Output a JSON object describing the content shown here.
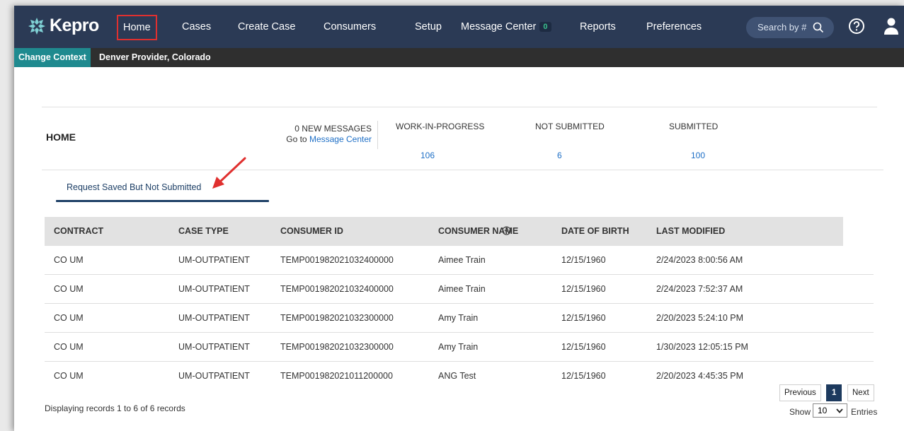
{
  "navbar": {
    "brand": "Kepro",
    "items": [
      {
        "label": "Home"
      },
      {
        "label": "Cases"
      },
      {
        "label": "Create Case"
      },
      {
        "label": "Consumers"
      },
      {
        "label": "Setup"
      },
      {
        "label": "Message Center",
        "badge": "0"
      },
      {
        "label": "Reports"
      },
      {
        "label": "Preferences"
      }
    ],
    "search_placeholder": "Search by #",
    "icons": [
      "search-icon",
      "help-icon",
      "user-icon"
    ],
    "active_highlight_color": "#e0302f",
    "background_color": "#2b3a55"
  },
  "context": {
    "button_label": "Change Context",
    "provider": "Denver Provider, Colorado"
  },
  "home": {
    "title": "HOME",
    "messages_count_text": "0 NEW MESSAGES",
    "goto_prefix": "Go to",
    "goto_link": "Message Center",
    "stats": [
      {
        "label": "WORK-IN-PROGRESS",
        "value": "106"
      },
      {
        "label": "NOT SUBMITTED",
        "value": "6"
      },
      {
        "label": "SUBMITTED",
        "value": "100"
      }
    ]
  },
  "tab": {
    "label": "Request Saved But Not Submitted"
  },
  "table": {
    "columns": [
      "CONTRACT",
      "CASE TYPE",
      "CONSUMER ID",
      "CONSUMER NAME",
      "DATE OF BIRTH",
      "LAST MODIFIED"
    ],
    "rows": [
      [
        "CO UM",
        "UM-OUTPATIENT",
        "TEMP001982021032400000",
        "Aimee Train",
        "12/15/1960",
        "2/24/2023 8:00:56 AM"
      ],
      [
        "CO UM",
        "UM-OUTPATIENT",
        "TEMP001982021032400000",
        "Aimee Train",
        "12/15/1960",
        "2/24/2023 7:52:37 AM"
      ],
      [
        "CO UM",
        "UM-OUTPATIENT",
        "TEMP001982021032300000",
        "Amy Train",
        "12/15/1960",
        "2/20/2023 5:24:10 PM"
      ],
      [
        "CO UM",
        "UM-OUTPATIENT",
        "TEMP001982021032300000",
        "Amy Train",
        "12/15/1960",
        "1/30/2023 12:05:15 PM"
      ],
      [
        "CO UM",
        "UM-OUTPATIENT",
        "TEMP001982021011200000",
        "ANG Test",
        "12/15/1960",
        "2/20/2023 4:45:35 PM"
      ]
    ]
  },
  "footer": {
    "records_text": "Displaying records 1 to 6 of 6 records",
    "previous": "Previous",
    "current_page": "1",
    "next": "Next",
    "show_label": "Show",
    "page_size": "10",
    "entries_label": "Entries"
  },
  "colors": {
    "link": "#1e6fc6",
    "accent_teal": "#1f8a8f",
    "dark_navy": "#1d3a5e",
    "annotation_arrow": "#e0302f"
  }
}
